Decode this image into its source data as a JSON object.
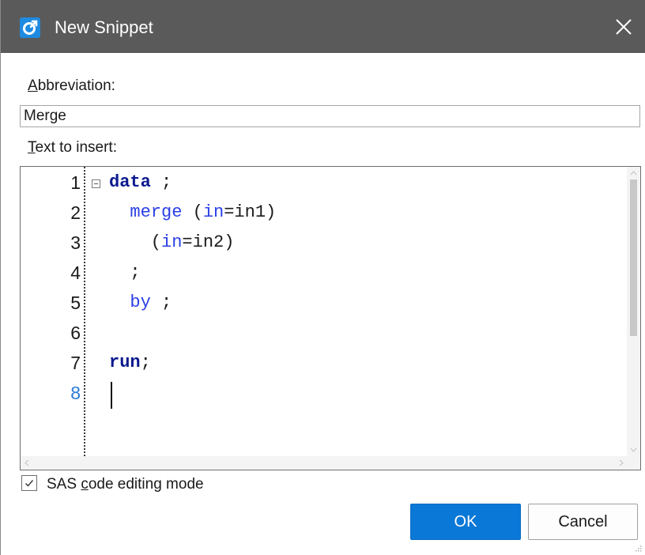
{
  "window": {
    "title": "New Snippet",
    "app_icon": "sas-logo-icon",
    "close_icon": "close-icon"
  },
  "abbreviation": {
    "label_mnemonic": "A",
    "label_rest": "bbreviation:",
    "value": "Merge"
  },
  "text_to_insert": {
    "label_mnemonic": "T",
    "label_rest": "ext to insert:"
  },
  "editor": {
    "line_numbers": [
      "1",
      "2",
      "3",
      "4",
      "5",
      "6",
      "7",
      "8"
    ],
    "lines": [
      [
        {
          "t": "data",
          "c": "kw-bold"
        },
        {
          "t": " ;",
          "c": ""
        }
      ],
      [
        {
          "t": "  ",
          "c": ""
        },
        {
          "t": "merge",
          "c": "kw-blue"
        },
        {
          "t": " (",
          "c": ""
        },
        {
          "t": "in",
          "c": "kw-blue"
        },
        {
          "t": "=in1)",
          "c": ""
        }
      ],
      [
        {
          "t": "    (",
          "c": ""
        },
        {
          "t": "in",
          "c": "kw-blue"
        },
        {
          "t": "=in2)",
          "c": ""
        }
      ],
      [
        {
          "t": "  ;",
          "c": ""
        }
      ],
      [
        {
          "t": "  ",
          "c": ""
        },
        {
          "t": "by",
          "c": "kw-blue"
        },
        {
          "t": " ;",
          "c": ""
        }
      ],
      [
        {
          "t": "",
          "c": ""
        }
      ],
      [
        {
          "t": "run",
          "c": "kw-bold"
        },
        {
          "t": ";",
          "c": ""
        }
      ],
      [
        {
          "t": "",
          "c": ""
        }
      ]
    ],
    "active_line": "8"
  },
  "sas_mode": {
    "checked": true,
    "label_pre": "SAS ",
    "label_mnemonic": "c",
    "label_rest": "ode editing mode"
  },
  "buttons": {
    "ok": "OK",
    "cancel": "Cancel"
  },
  "colors": {
    "titlebar": "#5a5a5a",
    "accent": "#0a78d6",
    "keyword_bold": "#0b1a8f",
    "keyword": "#2a3fe6",
    "active_line_number": "#2b7bd6"
  }
}
